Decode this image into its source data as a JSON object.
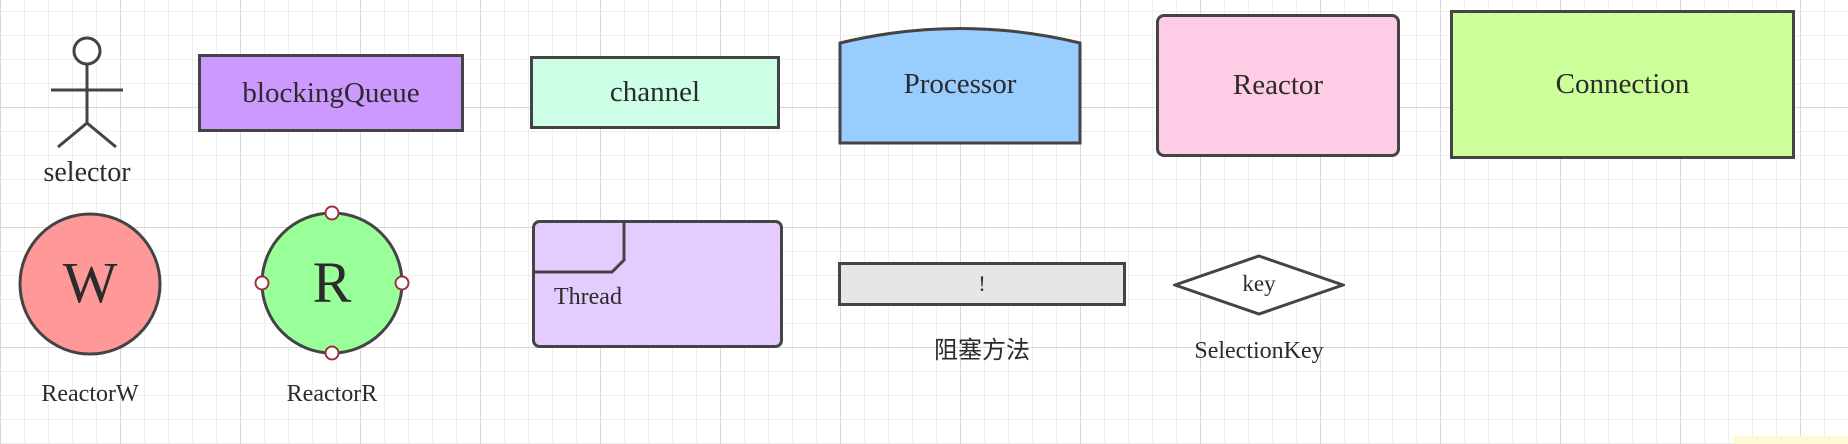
{
  "diagram": {
    "shapes": {
      "selector": {
        "label": "selector"
      },
      "blocking_queue": {
        "label": "blockingQueue",
        "fill": "#cc99ff"
      },
      "channel": {
        "label": "channel",
        "fill": "#ccffe6"
      },
      "processor": {
        "label": "Processor",
        "fill": "#99ccff"
      },
      "reactor": {
        "label": "Reactor",
        "fill": "#ffcce6"
      },
      "connection": {
        "label": "Connection",
        "fill": "#ccff99"
      },
      "reactor_w": {
        "glyph": "W",
        "label": "ReactorW",
        "fill": "#ff9999"
      },
      "reactor_r": {
        "glyph": "R",
        "label": "ReactorR",
        "fill": "#99ff99"
      },
      "thread": {
        "label": "Thread",
        "fill": "#e5ccff"
      },
      "blocking_method": {
        "glyph": "!",
        "label": "阻塞方法",
        "fill": "#e6e6e6"
      },
      "selection_key": {
        "glyph": "key",
        "label": "SelectionKey",
        "fill": "#ffffff"
      }
    },
    "stroke": "#444444",
    "handle_color": "#a0333a",
    "highlight_color": "#fff8d6"
  }
}
